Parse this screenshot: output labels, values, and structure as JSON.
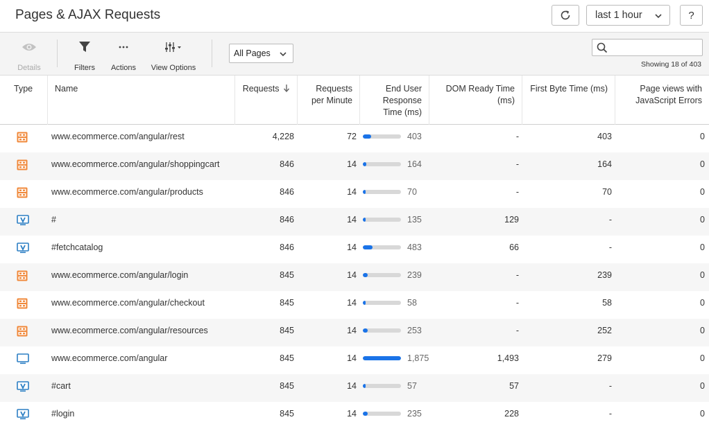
{
  "header": {
    "title": "Pages & AJAX Requests",
    "time_range": "last 1 hour",
    "help_label": "?"
  },
  "toolbar": {
    "details_label": "Details",
    "filters_label": "Filters",
    "actions_label": "Actions",
    "view_options_label": "View Options",
    "page_filter": "All Pages",
    "search_placeholder": "",
    "showing": "Showing 18 of 403"
  },
  "table": {
    "columns": {
      "type": "Type",
      "name": "Name",
      "requests": "Requests",
      "rpm_1": "Requests",
      "rpm_2": "per Minute",
      "eurt_1": "End User",
      "eurt_2": "Response",
      "eurt_3": "Time (ms)",
      "dom_1": "DOM Ready Time",
      "dom_2": "(ms)",
      "fbt": "First Byte Time (ms)",
      "err_1": "Page views with",
      "err_2": "JavaScript Errors"
    },
    "rows": [
      {
        "type": "ajax",
        "name": "www.ecommerce.com/angular/rest",
        "requests": "4,228",
        "rpm": "72",
        "response": "403",
        "response_ms": 403,
        "dom": "-",
        "first_byte": "403",
        "js_errors": "0"
      },
      {
        "type": "ajax",
        "name": "www.ecommerce.com/angular/shoppingcart",
        "requests": "846",
        "rpm": "14",
        "response": "164",
        "response_ms": 164,
        "dom": "-",
        "first_byte": "164",
        "js_errors": "0"
      },
      {
        "type": "ajax",
        "name": "www.ecommerce.com/angular/products",
        "requests": "846",
        "rpm": "14",
        "response": "70",
        "response_ms": 70,
        "dom": "-",
        "first_byte": "70",
        "js_errors": "0"
      },
      {
        "type": "virtual",
        "name": "#",
        "requests": "846",
        "rpm": "14",
        "response": "135",
        "response_ms": 135,
        "dom": "129",
        "first_byte": "-",
        "js_errors": "0"
      },
      {
        "type": "virtual",
        "name": "#fetchcatalog",
        "requests": "846",
        "rpm": "14",
        "response": "483",
        "response_ms": 483,
        "dom": "66",
        "first_byte": "-",
        "js_errors": "0"
      },
      {
        "type": "ajax",
        "name": "www.ecommerce.com/angular/login",
        "requests": "845",
        "rpm": "14",
        "response": "239",
        "response_ms": 239,
        "dom": "-",
        "first_byte": "239",
        "js_errors": "0"
      },
      {
        "type": "ajax",
        "name": "www.ecommerce.com/angular/checkout",
        "requests": "845",
        "rpm": "14",
        "response": "58",
        "response_ms": 58,
        "dom": "-",
        "first_byte": "58",
        "js_errors": "0"
      },
      {
        "type": "ajax",
        "name": "www.ecommerce.com/angular/resources",
        "requests": "845",
        "rpm": "14",
        "response": "253",
        "response_ms": 253,
        "dom": "-",
        "first_byte": "252",
        "js_errors": "0"
      },
      {
        "type": "page",
        "name": "www.ecommerce.com/angular",
        "requests": "845",
        "rpm": "14",
        "response": "1,875",
        "response_ms": 1875,
        "dom": "1,493",
        "first_byte": "279",
        "js_errors": "0"
      },
      {
        "type": "virtual",
        "name": "#cart",
        "requests": "845",
        "rpm": "14",
        "response": "57",
        "response_ms": 57,
        "dom": "57",
        "first_byte": "-",
        "js_errors": "0"
      },
      {
        "type": "virtual",
        "name": "#login",
        "requests": "845",
        "rpm": "14",
        "response": "235",
        "response_ms": 235,
        "dom": "228",
        "first_byte": "-",
        "js_errors": "0"
      }
    ]
  },
  "colors": {
    "ajax_icon": "#f0883a",
    "page_icon": "#2c7fc4",
    "bar_fill": "#1a73e8",
    "bar_track": "#d8d8d8"
  }
}
